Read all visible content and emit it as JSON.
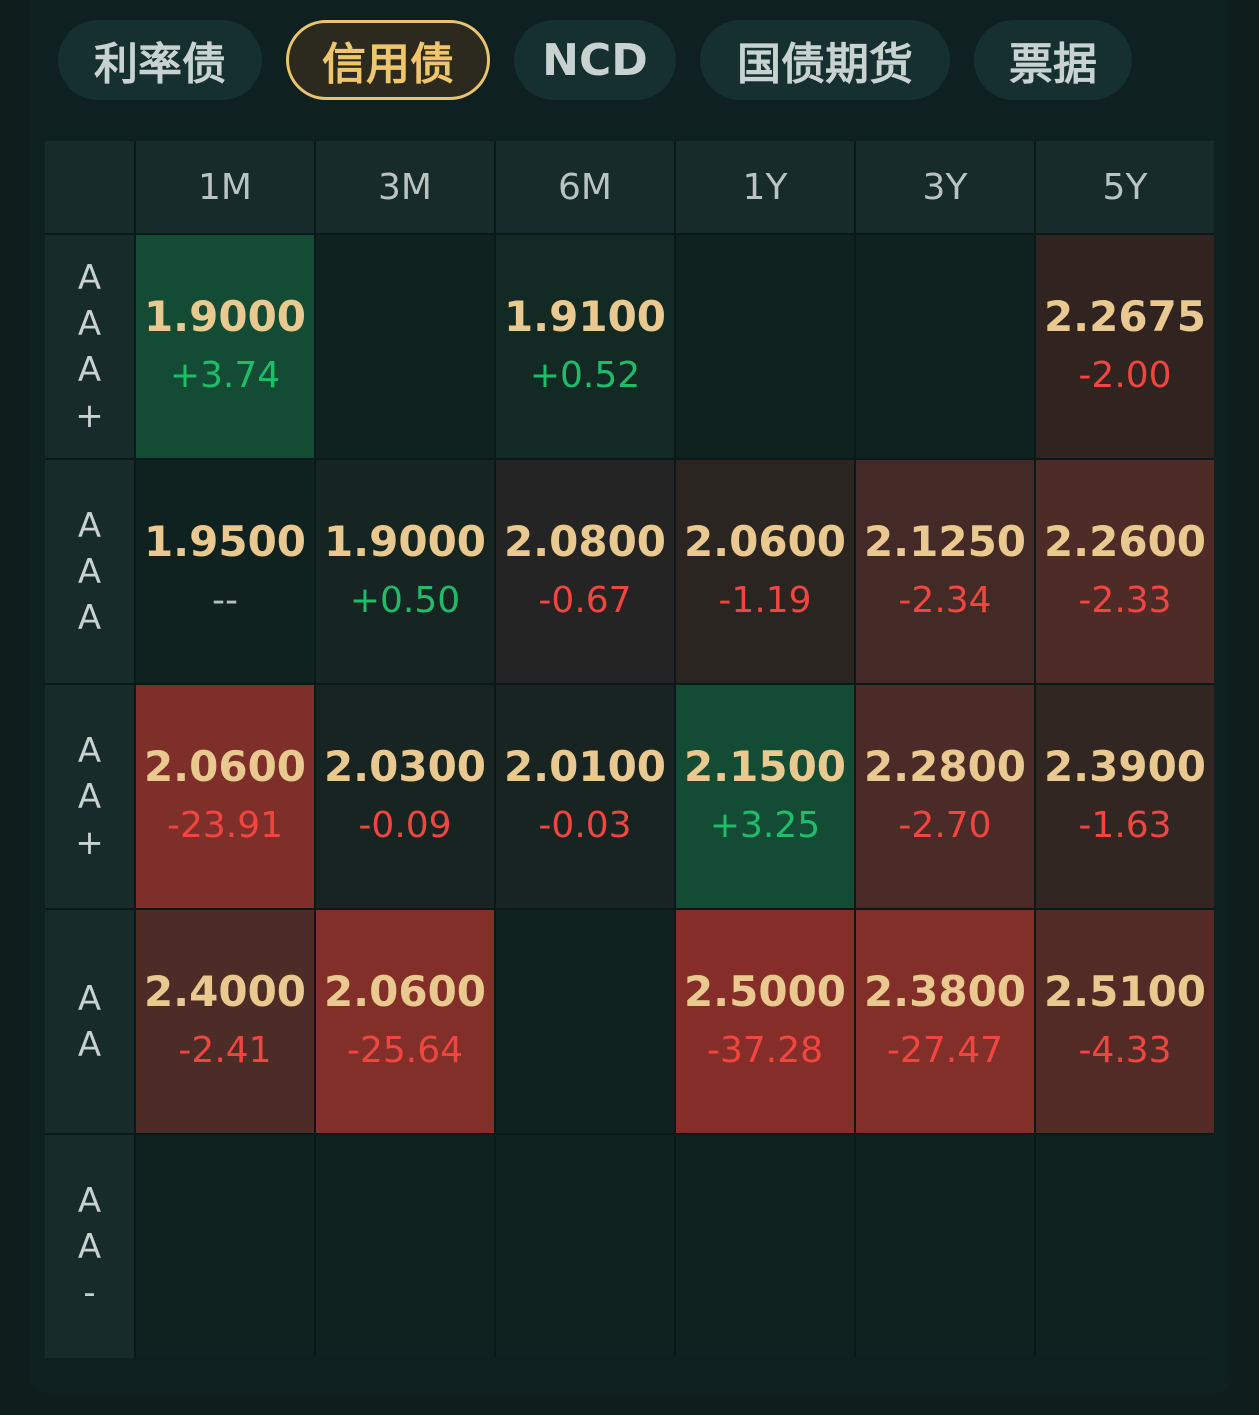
{
  "tabs": [
    {
      "label": "利率债",
      "active": false
    },
    {
      "label": "信用债",
      "active": true
    },
    {
      "label": "NCD",
      "active": false
    },
    {
      "label": "国债期货",
      "active": false
    },
    {
      "label": "票据",
      "active": false
    }
  ],
  "columns": [
    "1M",
    "3M",
    "6M",
    "1Y",
    "3Y",
    "5Y"
  ],
  "rows": [
    {
      "rating": "AAA+",
      "cells": [
        {
          "value": "1.9000",
          "change": "+3.74",
          "dir": "up",
          "bg": "#134b34"
        },
        {
          "value": "",
          "change": "",
          "dir": "flat",
          "bg": "#102220"
        },
        {
          "value": "1.9100",
          "change": "+0.52",
          "dir": "up",
          "bg": "#132a24"
        },
        {
          "value": "",
          "change": "",
          "dir": "flat",
          "bg": "#102220"
        },
        {
          "value": "",
          "change": "",
          "dir": "flat",
          "bg": "#102220"
        },
        {
          "value": "2.2675",
          "change": "-2.00",
          "dir": "down",
          "bg": "#302320"
        }
      ]
    },
    {
      "rating": "AAA",
      "cells": [
        {
          "value": "1.9500",
          "change": "--",
          "dir": "flat",
          "bg": "#102220"
        },
        {
          "value": "1.9000",
          "change": "+0.50",
          "dir": "up",
          "bg": "#162522"
        },
        {
          "value": "2.0800",
          "change": "-0.67",
          "dir": "down",
          "bg": "#232423"
        },
        {
          "value": "2.0600",
          "change": "-1.19",
          "dir": "down",
          "bg": "#2b2522"
        },
        {
          "value": "2.1250",
          "change": "-2.34",
          "dir": "down",
          "bg": "#432a26"
        },
        {
          "value": "2.2600",
          "change": "-2.33",
          "dir": "down",
          "bg": "#4e2b27"
        }
      ]
    },
    {
      "rating": "AA+",
      "cells": [
        {
          "value": "2.0600",
          "change": "-23.91",
          "dir": "down",
          "bg": "#7f2f29"
        },
        {
          "value": "2.0300",
          "change": "-0.09",
          "dir": "down",
          "bg": "#182422"
        },
        {
          "value": "2.0100",
          "change": "-0.03",
          "dir": "down",
          "bg": "#182422"
        },
        {
          "value": "2.1500",
          "change": "+3.25",
          "dir": "up",
          "bg": "#134b34"
        },
        {
          "value": "2.2800",
          "change": "-2.70",
          "dir": "down",
          "bg": "#4b2b27"
        },
        {
          "value": "2.3900",
          "change": "-1.63",
          "dir": "down",
          "bg": "#322623"
        }
      ]
    },
    {
      "rating": "AA",
      "cells": [
        {
          "value": "2.4000",
          "change": "-2.41",
          "dir": "down",
          "bg": "#4d2b27"
        },
        {
          "value": "2.0600",
          "change": "-25.64",
          "dir": "down",
          "bg": "#822f29"
        },
        {
          "value": "",
          "change": "",
          "dir": "flat",
          "bg": "#102220"
        },
        {
          "value": "2.5000",
          "change": "-37.28",
          "dir": "down",
          "bg": "#852e29"
        },
        {
          "value": "2.3800",
          "change": "-27.47",
          "dir": "down",
          "bg": "#832f29"
        },
        {
          "value": "2.5100",
          "change": "-4.33",
          "dir": "down",
          "bg": "#522b27"
        }
      ]
    },
    {
      "rating": "AA-",
      "cells": [
        {
          "value": "",
          "change": "",
          "dir": "flat",
          "bg": "#102220"
        },
        {
          "value": "",
          "change": "",
          "dir": "flat",
          "bg": "#102220"
        },
        {
          "value": "",
          "change": "",
          "dir": "flat",
          "bg": "#102220"
        },
        {
          "value": "",
          "change": "",
          "dir": "flat",
          "bg": "#102220"
        },
        {
          "value": "",
          "change": "",
          "dir": "flat",
          "bg": "#102220"
        },
        {
          "value": "",
          "change": "",
          "dir": "flat",
          "bg": "#102220"
        }
      ]
    }
  ]
}
